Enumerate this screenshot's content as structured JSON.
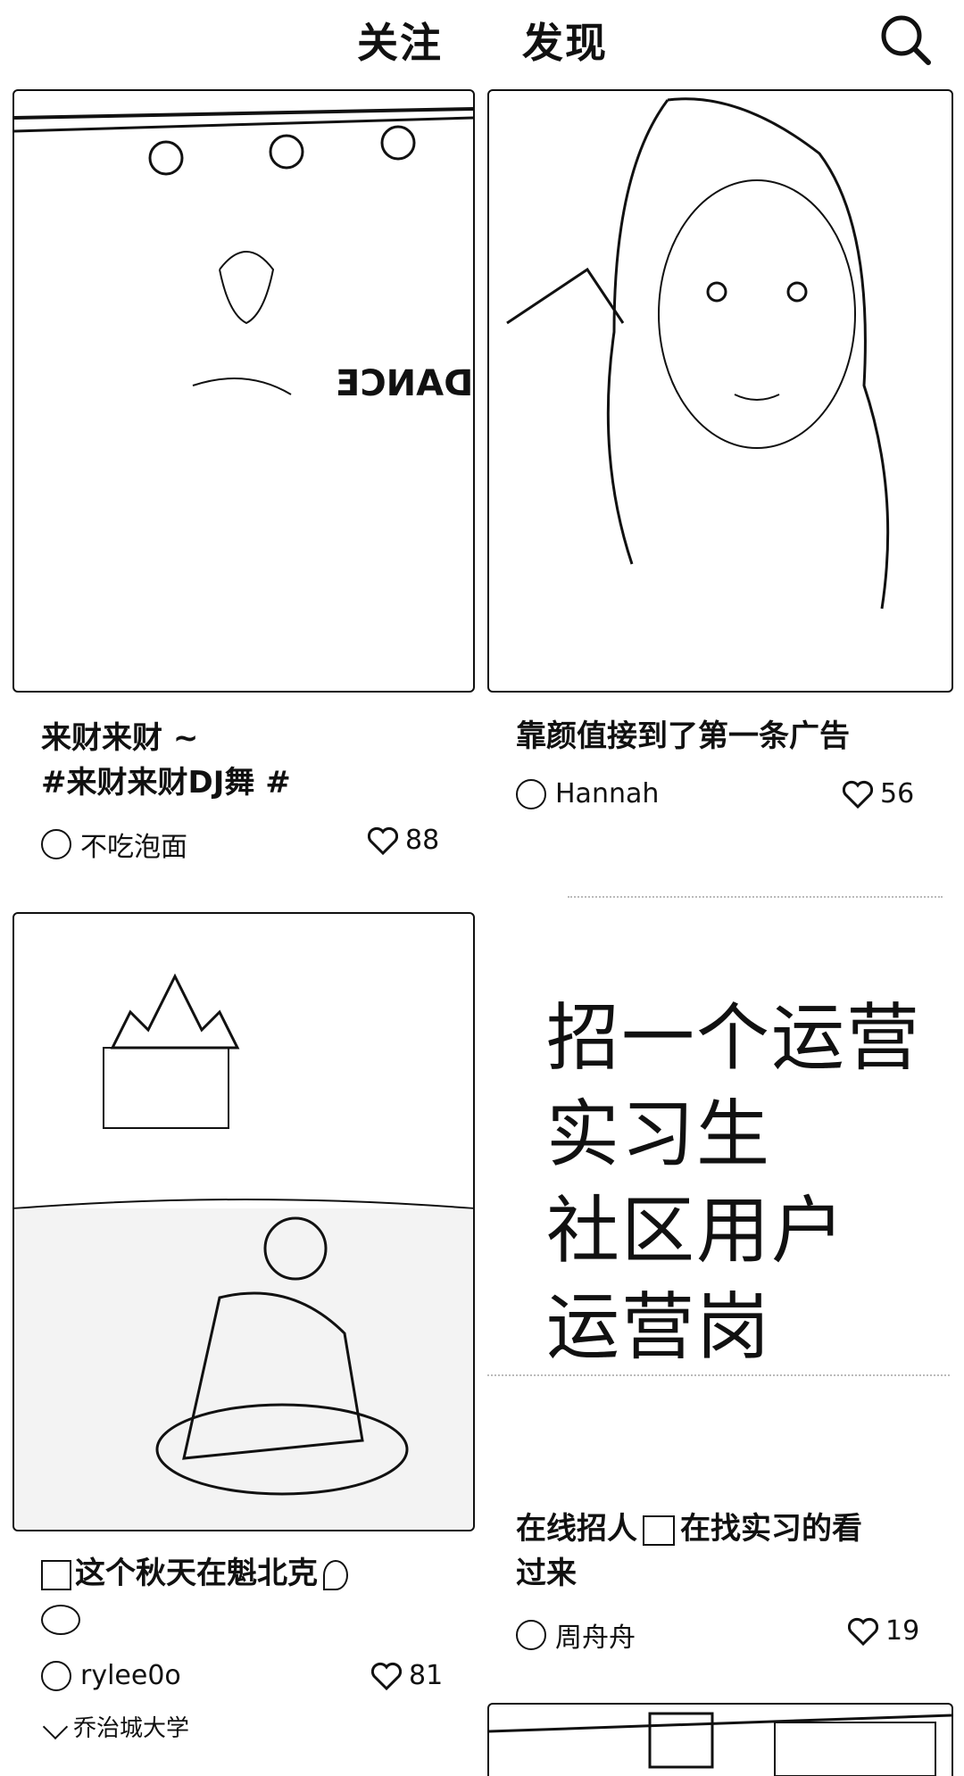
{
  "header": {
    "tabs": [
      {
        "label": "关注"
      },
      {
        "label": "发现"
      }
    ],
    "search_icon": "search-icon"
  },
  "feed": {
    "cards": [
      {
        "title_line1": "来财来财 ~",
        "title_line2": "#来财来财DJ舞 #",
        "author": "不吃泡面",
        "likes": "88",
        "image_text": "DANCE"
      },
      {
        "title_line1": "靠颜值接到了第一条广告",
        "author": "Hannah",
        "likes": "56"
      },
      {
        "title_line1": "这个秋天在魁北克",
        "author": "rylee0o",
        "likes": "81",
        "school": "乔治城大学"
      },
      {
        "recruit_lines": [
          "招一个运营",
          "实习生",
          "社区用户",
          "运营岗"
        ],
        "title_line1": "在线招人",
        "title_line1b": "在找实习的看",
        "title_line2": "过来",
        "author": "周舟舟",
        "likes": "19"
      }
    ]
  },
  "colors": {
    "background": "#ffffff",
    "text": "#111111",
    "outline": "#111111"
  }
}
